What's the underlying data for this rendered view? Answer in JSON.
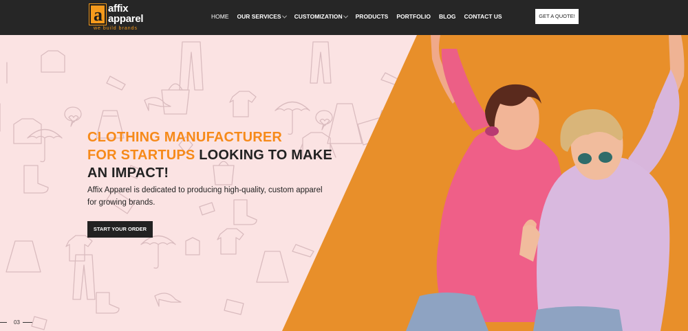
{
  "brand": {
    "logo_letter": "a",
    "line1": "affix",
    "line2": "apparel",
    "tagline": "we build brands",
    "accent": "#f59a1c"
  },
  "nav": {
    "items": [
      {
        "label": "HOME",
        "has_dropdown": false
      },
      {
        "label": "OUR SERVICES",
        "has_dropdown": true
      },
      {
        "label": "CUSTOMIZATION",
        "has_dropdown": true
      },
      {
        "label": "PRODUCTS",
        "has_dropdown": false
      },
      {
        "label": "PORTFOLIO",
        "has_dropdown": false
      },
      {
        "label": "BLOG",
        "has_dropdown": false
      },
      {
        "label": "CONTACT US",
        "has_dropdown": false
      }
    ],
    "cta": "GET A QUOTE!",
    "background": "#262626"
  },
  "hero": {
    "headline_orange_1": "CLOTHING MANUFACTURER",
    "headline_orange_2": "FOR STARTUPS",
    "headline_dark_1": " LOOKING TO MAKE",
    "headline_dark_2": "AN IMPACT!",
    "subtext": "Affix Apparel is dedicated to producing high-quality, custom apparel for growing brands.",
    "button": "START YOUR ORDER",
    "slide_number": "03",
    "left_bg": "#fbe3e3",
    "right_bg": "#e88f2a"
  }
}
